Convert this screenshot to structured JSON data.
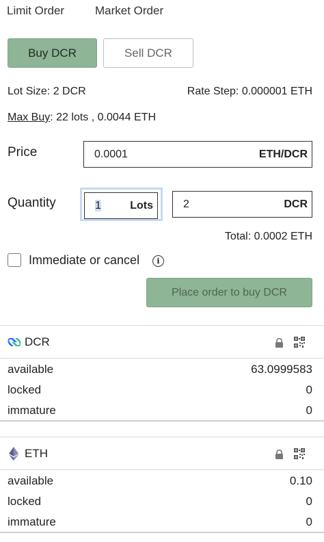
{
  "tabs": {
    "limit": "Limit Order",
    "market": "Market Order"
  },
  "side": {
    "buy": "Buy DCR",
    "sell": "Sell DCR"
  },
  "info": {
    "lot_size": "Lot Size: 2 DCR",
    "rate_step": "Rate Step: 0.000001 ETH",
    "max_buy_label": "Max Buy",
    "max_buy_value": ": 22 lots , 0.0044 ETH"
  },
  "price": {
    "label": "Price",
    "value": "0.0001",
    "unit": "ETH/DCR"
  },
  "quantity": {
    "label": "Quantity",
    "lots_value": "1",
    "lots_unit": "Lots",
    "dcr_value": "2",
    "dcr_unit": "DCR"
  },
  "total": "Total: 0.0002 ETH",
  "ioc": {
    "label": "Immediate or cancel",
    "checked": false
  },
  "place_order": "Place order to buy DCR",
  "wallets": [
    {
      "asset": "DCR",
      "icon": "decred-icon",
      "rows": [
        {
          "label": "available",
          "value": "63.0999583"
        },
        {
          "label": "locked",
          "value": "0"
        },
        {
          "label": "immature",
          "value": "0"
        }
      ]
    },
    {
      "asset": "ETH",
      "icon": "ethereum-icon",
      "rows": [
        {
          "label": "available",
          "value": "0.10"
        },
        {
          "label": "locked",
          "value": "0"
        },
        {
          "label": "immature",
          "value": "0"
        }
      ]
    }
  ],
  "colors": {
    "buy_green": "#8db596",
    "focus_blue": "#c6d9f1",
    "decred_blue": "#2970ff",
    "decred_teal": "#41bf90"
  }
}
